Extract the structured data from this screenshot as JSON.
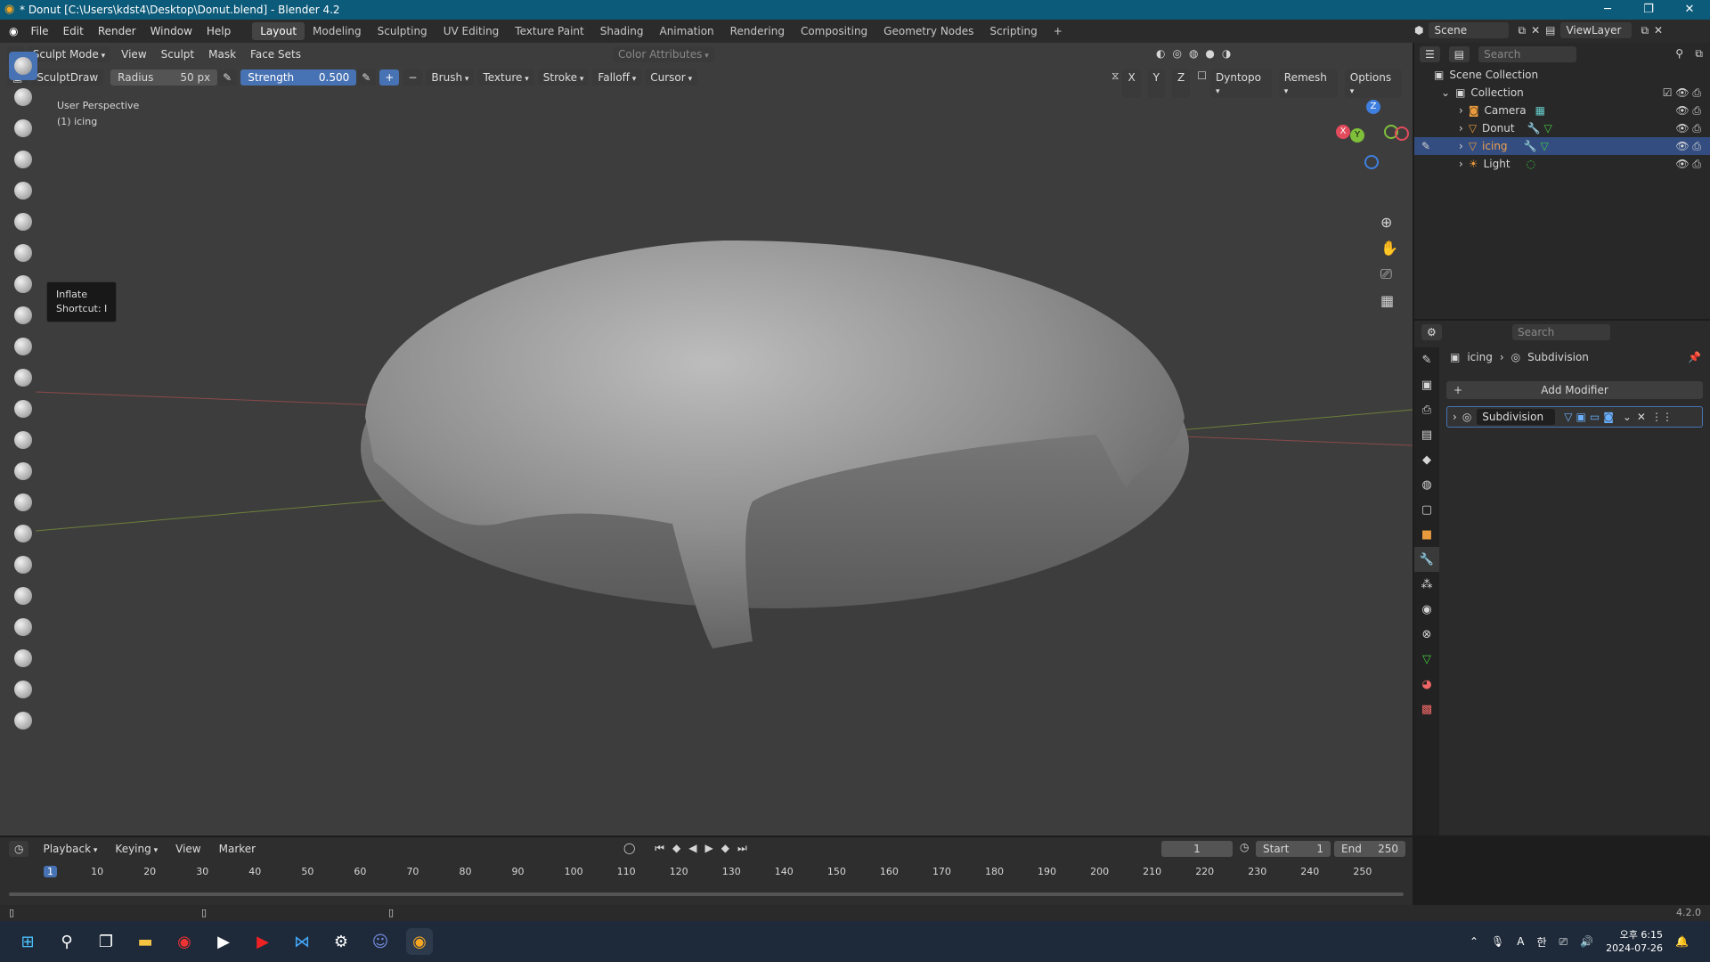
{
  "titlebar": {
    "title": "* Donut [C:\\Users\\kdst4\\Desktop\\Donut.blend] - Blender 4.2",
    "minimize": "─",
    "maximize": "❐",
    "close": "✕"
  },
  "menu": [
    "File",
    "Edit",
    "Render",
    "Window",
    "Help"
  ],
  "workspaces": [
    "Layout",
    "Modeling",
    "Sculpting",
    "UV Editing",
    "Texture Paint",
    "Shading",
    "Animation",
    "Rendering",
    "Compositing",
    "Geometry Nodes",
    "Scripting"
  ],
  "scene": {
    "label": "Scene",
    "viewlayer": "ViewLayer"
  },
  "viewport_header": {
    "mode": "Sculpt Mode",
    "items": [
      "View",
      "Sculpt",
      "Mask",
      "Face Sets"
    ],
    "color_attributes": "Color Attributes"
  },
  "tool_settings": {
    "brush_name": "SculptDraw",
    "radius_label": "Radius",
    "radius_value": "50 px",
    "strength_label": "Strength",
    "strength_value": "0.500",
    "menus": [
      "Brush",
      "Texture",
      "Stroke",
      "Falloff",
      "Cursor"
    ],
    "axes": [
      "X",
      "Y",
      "Z"
    ],
    "dyntopo": "Dyntopo",
    "remesh": "Remesh",
    "options": "Options"
  },
  "viewport_info": {
    "perspective": "User Perspective",
    "object": "(1) icing"
  },
  "tooltip": {
    "title": "Inflate",
    "shortcut": "Shortcut: I"
  },
  "gizmo": {
    "x": "X",
    "y": "Y",
    "z": "Z"
  },
  "outliner": {
    "search_placeholder": "Search",
    "scene_collection": "Scene Collection",
    "collection": "Collection",
    "objects": [
      {
        "name": "Camera",
        "icon_color": "#9ec0d6"
      },
      {
        "name": "Donut",
        "icon_color": "#e89a3c"
      },
      {
        "name": "icing",
        "icon_color": "#e89a3c"
      },
      {
        "name": "Light",
        "icon_color": "#e89a3c"
      }
    ]
  },
  "properties": {
    "search_placeholder": "Search",
    "breadcrumb_object": "icing",
    "breadcrumb_modifier": "Subdivision",
    "add_modifier": "Add Modifier",
    "modifier_name": "Subdivision"
  },
  "timeline": {
    "menus": [
      "Playback",
      "Keying",
      "View",
      "Marker"
    ],
    "current_frame": "1",
    "start_label": "Start",
    "start_value": "1",
    "end_label": "End",
    "end_value": "250",
    "ticks": [
      "1",
      "10",
      "20",
      "30",
      "40",
      "50",
      "60",
      "70",
      "80",
      "90",
      "100",
      "110",
      "120",
      "130",
      "140",
      "150",
      "160",
      "170",
      "180",
      "190",
      "200",
      "210",
      "220",
      "230",
      "240",
      "250"
    ]
  },
  "statusbar": {
    "version": "4.2.0"
  },
  "taskbar": {
    "time": "오후 6:15",
    "date": "2024-07-26",
    "ime": "A",
    "lang": "한"
  },
  "colors": {
    "accent": "#4772b3",
    "selection": "#334d80",
    "titlebar": "#0d5b7a"
  }
}
